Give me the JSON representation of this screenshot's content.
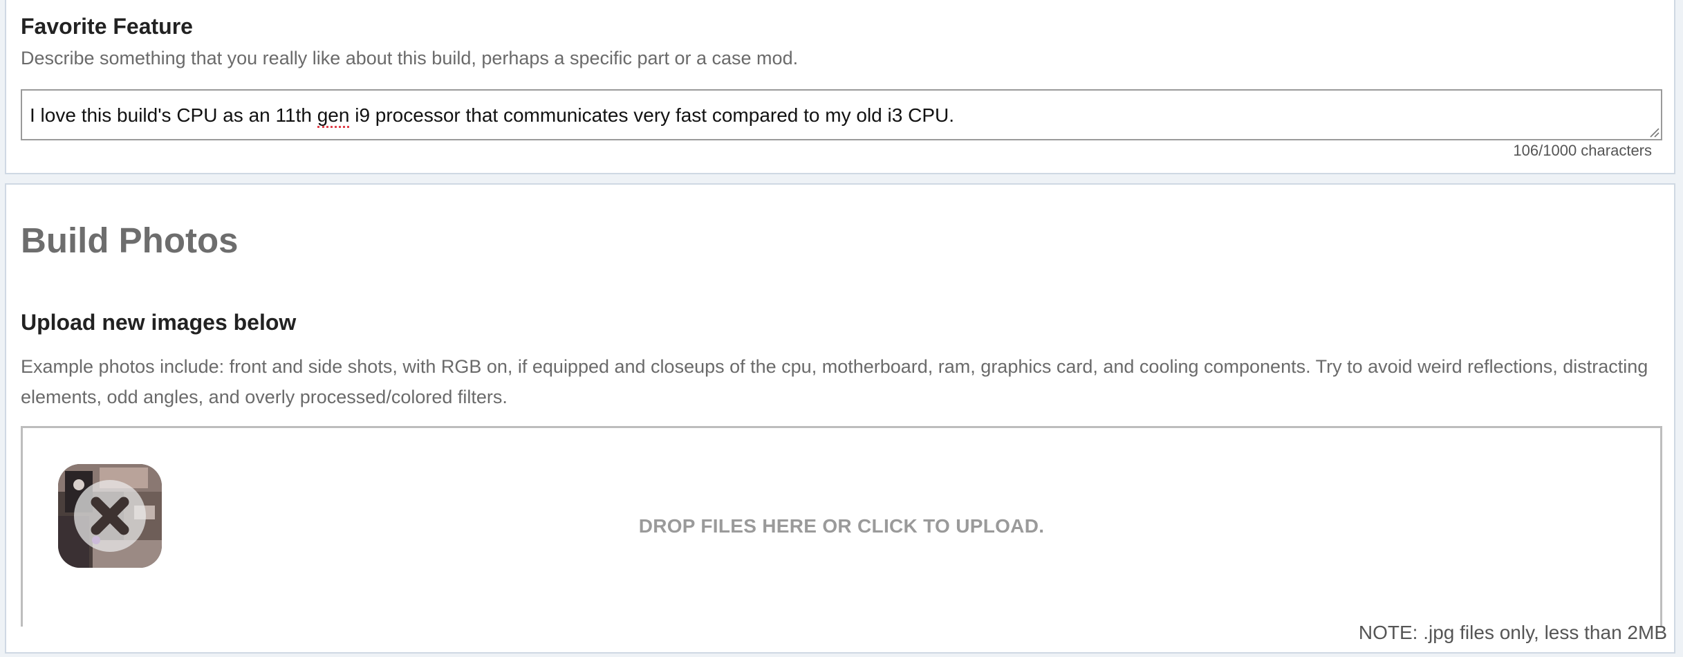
{
  "favorite_feature": {
    "title": "Favorite Feature",
    "description": "Describe something that you really like about this build, perhaps a specific part or a case mod.",
    "textarea": {
      "value_before": "I love this build's CPU as an 11th ",
      "value_misspelled": "gen",
      "value_after": " i9 processor that communicates very fast compared to my old i3 CPU."
    },
    "char_count": "106/1000 characters"
  },
  "build_photos": {
    "heading": "Build Photos",
    "upload_title": "Upload new images below",
    "description": "Example photos include: front and side shots, with RGB on, if equipped and closeups of the cpu, motherboard, ram, graphics card, and cooling components. Try to avoid weird reflections, distracting elements, odd angles, and overly processed/colored filters.",
    "dropzone_text": "DROP FILES HERE OR CLICK TO UPLOAD.",
    "uploaded_thumbnail": {
      "icon": "remove-x-icon"
    },
    "note": "NOTE: .jpg files only, less than 2MB"
  },
  "colors": {
    "panel_border": "#cfd8e3",
    "heading_gray": "#6d6d6d",
    "dropzone_text": "#9a9a9a"
  }
}
